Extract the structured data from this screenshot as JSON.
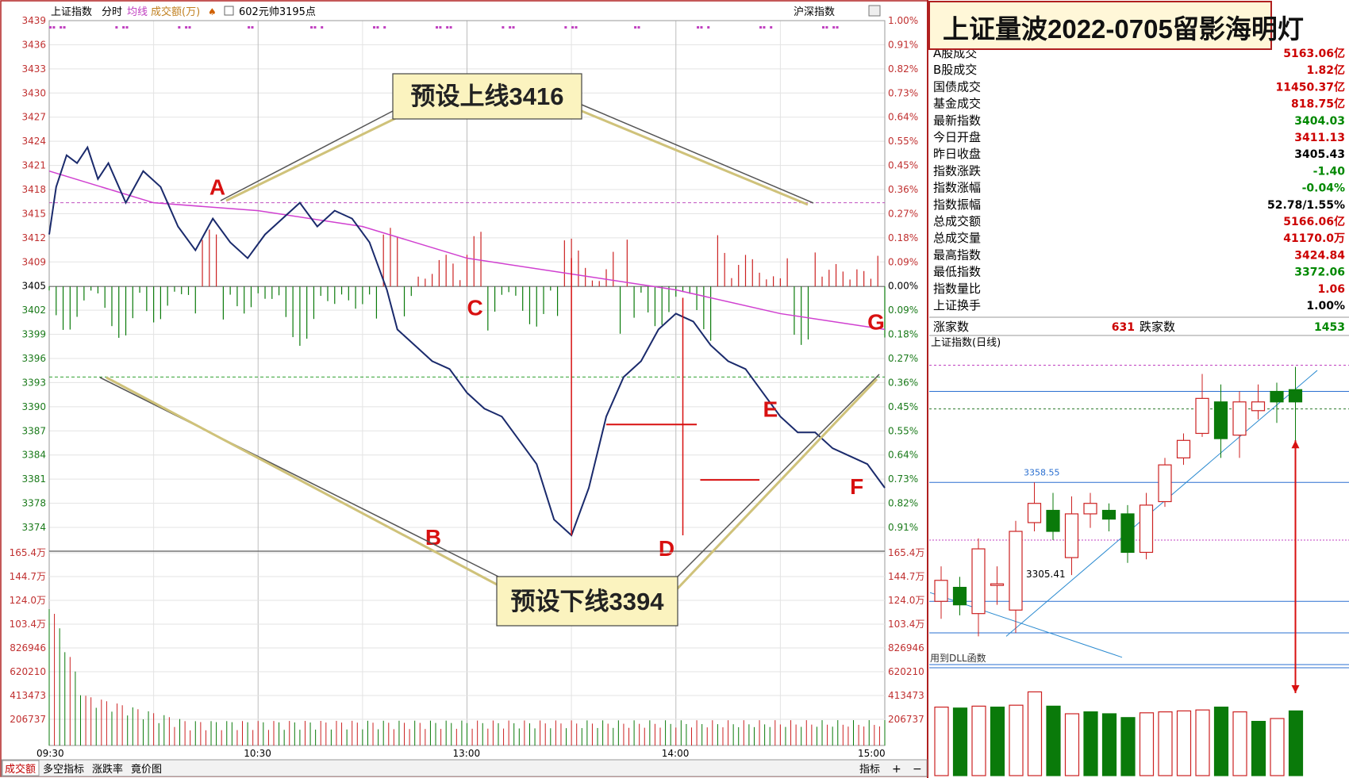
{
  "toolbar": {
    "symbol": "上证指数",
    "tab_intraday": "分时",
    "tab_avg": "均线",
    "tab_amount": "成交额(万)",
    "stock_note": "602元帅3195点",
    "market_label": "沪深指数"
  },
  "banner": {
    "title": "上证量波2022-0705留影海明灯"
  },
  "bottom_tabs": [
    "成交额",
    "多空指标",
    "涨跌率",
    "竟价图"
  ],
  "bottom_right": {
    "index_btn": "指标",
    "plus": "+",
    "minus": "−"
  },
  "annotations": {
    "upper_box": "预设上线3416",
    "lower_box": "预设下线3394",
    "points": [
      "A",
      "B",
      "C",
      "D",
      "E",
      "F",
      "G"
    ]
  },
  "stats": [
    {
      "label": "A股成交",
      "value": "5163.06亿",
      "color": "#cc0000"
    },
    {
      "label": "B股成交",
      "value": "1.82亿",
      "color": "#cc0000"
    },
    {
      "label": "国债成交",
      "value": "11450.37亿",
      "color": "#cc0000"
    },
    {
      "label": "基金成交",
      "value": "818.75亿",
      "color": "#cc0000"
    },
    {
      "label": "最新指数",
      "value": "3404.03",
      "color": "#008800"
    },
    {
      "label": "今日开盘",
      "value": "3411.13",
      "color": "#cc0000"
    },
    {
      "label": "昨日收盘",
      "value": "3405.43",
      "color": "#000000"
    },
    {
      "label": "指数涨跌",
      "value": "-1.40",
      "color": "#008800"
    },
    {
      "label": "指数涨幅",
      "value": "-0.04%",
      "color": "#008800"
    },
    {
      "label": "指数振幅",
      "value": "52.78/1.55%",
      "color": "#000000"
    },
    {
      "label": "总成交额",
      "value": "5166.06亿",
      "color": "#cc0000"
    },
    {
      "label": "总成交量",
      "value": "41170.0万",
      "color": "#cc0000"
    },
    {
      "label": "最高指数",
      "value": "3424.84",
      "color": "#cc0000"
    },
    {
      "label": "最低指数",
      "value": "3372.06",
      "color": "#008800"
    },
    {
      "label": "指数量比",
      "value": "1.06",
      "color": "#cc0000"
    },
    {
      "label": "上证换手",
      "value": "1.00%",
      "color": "#000000"
    }
  ],
  "breadth": {
    "up_label": "涨家数",
    "up_count": "631",
    "down_label": "跌家数",
    "down_count": "1453"
  },
  "daily_panel": {
    "title": "上证指数(日线)",
    "label_high": "3358.55",
    "label_low": "3305.41",
    "dll_note": "用到DLL函数"
  },
  "colors": {
    "up": "#cc2222",
    "down": "#0a7a0a",
    "price_line": "#1a2a6c",
    "avg_line": "#d040d0",
    "annot_box": "#fbf3bf",
    "annot_red": "#d81010"
  },
  "chart_data": [
    {
      "type": "line",
      "title": "上证指数 分时",
      "prev_close": 3405.43,
      "ylim": [
        3372,
        3439
      ],
      "y_ticks": [
        "3439",
        "3436",
        "3433",
        "3430",
        "3427",
        "3424",
        "3421",
        "3418",
        "3415",
        "3412",
        "3409",
        "3405",
        "3402",
        "3399",
        "3396",
        "3393",
        "3390",
        "3387",
        "3384",
        "3381",
        "3378",
        "3374"
      ],
      "pct_ticks": [
        "1.00%",
        "0.91%",
        "0.82%",
        "0.73%",
        "0.64%",
        "0.55%",
        "0.45%",
        "0.36%",
        "0.27%",
        "0.18%",
        "0.09%",
        "0.00%",
        "0.09%",
        "0.18%",
        "0.27%",
        "0.36%",
        "0.45%",
        "0.55%",
        "0.64%",
        "0.73%",
        "0.82%",
        "0.91%"
      ],
      "x_ticks": [
        "09:30",
        "10:30",
        "13:00",
        "14:00",
        "15:00"
      ],
      "upper_line": 3416,
      "lower_line": 3394,
      "series": [
        {
          "name": "价格",
          "minutes": [
            0,
            2,
            5,
            8,
            11,
            14,
            17,
            22,
            27,
            32,
            37,
            42,
            47,
            52,
            57,
            62,
            67,
            72,
            77,
            82,
            87,
            92,
            97,
            100,
            105,
            110,
            115,
            120,
            125,
            130,
            135,
            140,
            145,
            150,
            155,
            160,
            165,
            170,
            175,
            180,
            185,
            190,
            195,
            200,
            205,
            210,
            215,
            220,
            225,
            230,
            235,
            240
          ],
          "values": [
            3412,
            3418,
            3422,
            3421,
            3423,
            3419,
            3421,
            3416,
            3420,
            3418,
            3413,
            3410,
            3414,
            3411,
            3409,
            3412,
            3414,
            3416,
            3413,
            3415,
            3414,
            3411,
            3405,
            3400,
            3398,
            3396,
            3395,
            3392,
            3390,
            3389,
            3386,
            3383,
            3376,
            3374,
            3380,
            3389,
            3394,
            3396,
            3400,
            3402,
            3401,
            3398,
            3396,
            3395,
            3392,
            3389,
            3387,
            3387,
            3385,
            3384,
            3383,
            3380
          ]
        },
        {
          "name": "均线",
          "minutes": [
            0,
            30,
            60,
            90,
            120,
            150,
            180,
            210,
            240
          ],
          "values": [
            3420,
            3416,
            3415,
            3413,
            3409,
            3407,
            3405,
            3402,
            3400
          ]
        }
      ],
      "annotation_points": [
        {
          "label": "A",
          "time": "10:18",
          "price": 3416
        },
        {
          "label": "B",
          "time": "11:12",
          "price": 3374
        },
        {
          "label": "C",
          "time": "13:05",
          "price": 3402
        },
        {
          "label": "D",
          "time": "14:02",
          "price": 3374
        },
        {
          "label": "E",
          "time": "14:17",
          "price": 3388
        },
        {
          "label": "F",
          "time": "14:31",
          "price": 3381
        },
        {
          "label": "G",
          "time": "14:58",
          "price": 3403
        }
      ]
    },
    {
      "type": "bar",
      "title": "成交额",
      "y_ticks": [
        "165.4万",
        "144.7万",
        "124.0万",
        "103.4万",
        "826946",
        "620210",
        "413473",
        "206737"
      ],
      "ylim": [
        0,
        1654000
      ]
    },
    {
      "type": "bar",
      "title": "上证指数(日线)",
      "candles": [
        {
          "o": 3290,
          "c": 3302,
          "h": 3310,
          "l": 3280
        },
        {
          "o": 3298,
          "c": 3288,
          "h": 3304,
          "l": 3282
        },
        {
          "o": 3283,
          "c": 3320,
          "h": 3326,
          "l": 3270
        },
        {
          "o": 3300,
          "c": 3300,
          "h": 3310,
          "l": 3288
        },
        {
          "o": 3285,
          "c": 3330,
          "h": 3336,
          "l": 3272
        },
        {
          "o": 3335,
          "c": 3346,
          "h": 3358,
          "l": 3330
        },
        {
          "o": 3342,
          "c": 3330,
          "h": 3352,
          "l": 3325
        },
        {
          "o": 3315,
          "c": 3340,
          "h": 3350,
          "l": 3305
        },
        {
          "o": 3340,
          "c": 3346,
          "h": 3352,
          "l": 3332
        },
        {
          "o": 3342,
          "c": 3337,
          "h": 3346,
          "l": 3330
        },
        {
          "o": 3340,
          "c": 3318,
          "h": 3345,
          "l": 3312
        },
        {
          "o": 3318,
          "c": 3345,
          "h": 3352,
          "l": 3314
        },
        {
          "o": 3347,
          "c": 3368,
          "h": 3372,
          "l": 3344
        },
        {
          "o": 3372,
          "c": 3382,
          "h": 3386,
          "l": 3368
        },
        {
          "o": 3386,
          "c": 3406,
          "h": 3420,
          "l": 3384
        },
        {
          "o": 3404,
          "c": 3383,
          "h": 3414,
          "l": 3372
        },
        {
          "o": 3385,
          "c": 3404,
          "h": 3410,
          "l": 3372
        },
        {
          "o": 3399,
          "c": 3404,
          "h": 3414,
          "l": 3394
        },
        {
          "o": 3410,
          "c": 3404,
          "h": 3415,
          "l": 3392
        },
        {
          "o": 3411,
          "c": 3404,
          "h": 3424,
          "l": 3372
        }
      ],
      "volumes": [
        {
          "v": 0.72,
          "up": true
        },
        {
          "v": 0.71,
          "up": false
        },
        {
          "v": 0.73,
          "up": true
        },
        {
          "v": 0.72,
          "up": false
        },
        {
          "v": 0.74,
          "up": true
        },
        {
          "v": 0.88,
          "up": true
        },
        {
          "v": 0.73,
          "up": false
        },
        {
          "v": 0.65,
          "up": true
        },
        {
          "v": 0.67,
          "up": false
        },
        {
          "v": 0.65,
          "up": false
        },
        {
          "v": 0.61,
          "up": false
        },
        {
          "v": 0.66,
          "up": true
        },
        {
          "v": 0.67,
          "up": true
        },
        {
          "v": 0.68,
          "up": true
        },
        {
          "v": 0.69,
          "up": true
        },
        {
          "v": 0.72,
          "up": false
        },
        {
          "v": 0.67,
          "up": true
        },
        {
          "v": 0.57,
          "up": false
        },
        {
          "v": 0.6,
          "up": true
        },
        {
          "v": 0.68,
          "up": false
        }
      ]
    }
  ]
}
